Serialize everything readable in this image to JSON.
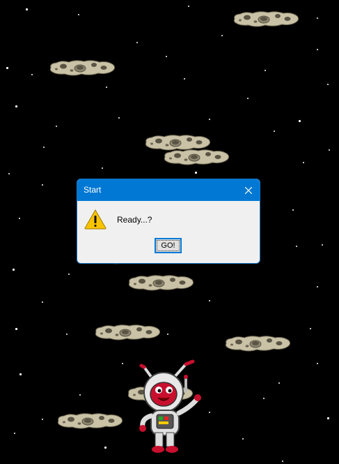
{
  "window": {
    "title": "Start"
  },
  "dialog": {
    "message": "Ready...?",
    "button_label": "GO!",
    "icon": "warning-icon"
  },
  "colors": {
    "space": "#000000",
    "titlebar": "#0078d4",
    "dialog_bg": "#f0f0f0",
    "asteroid": "#c9c2a6"
  }
}
